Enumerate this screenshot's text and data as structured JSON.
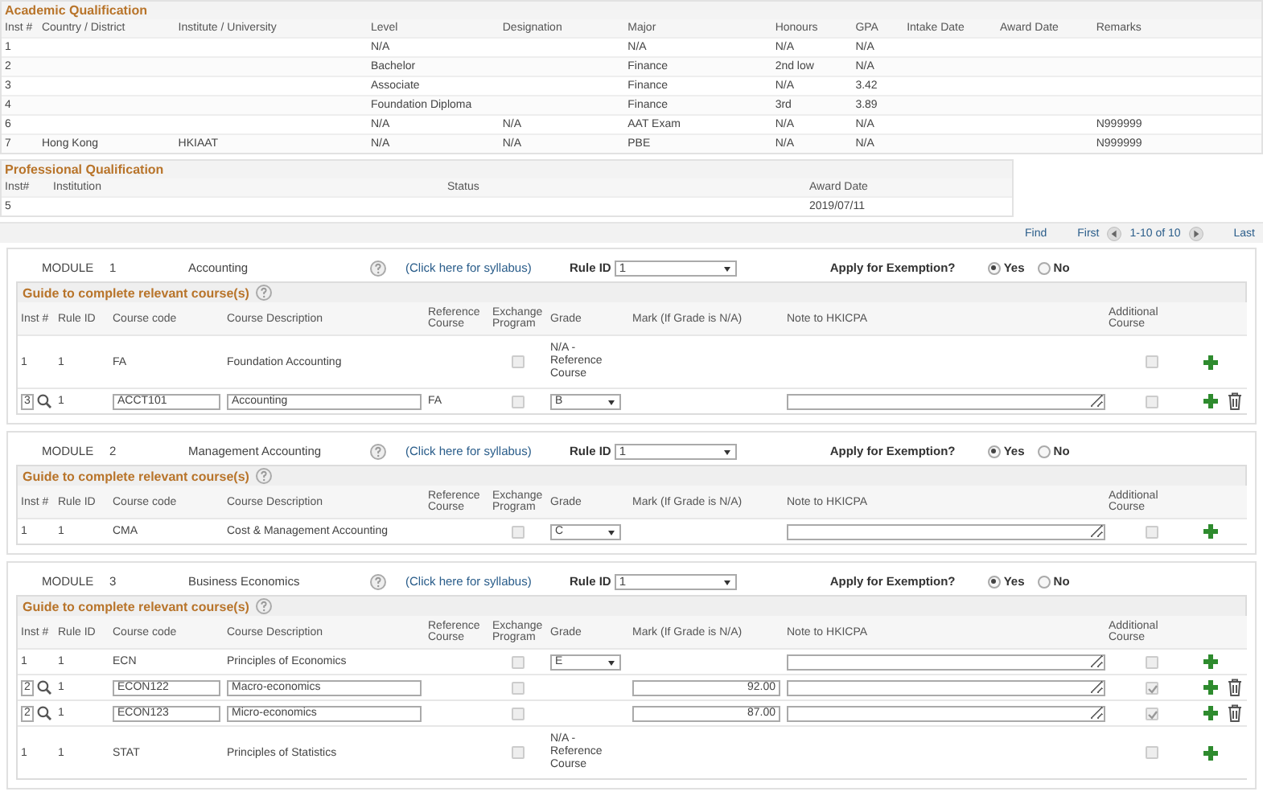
{
  "academic_qualification": {
    "title": "Academic Qualification",
    "columns": [
      "Inst #",
      "Country / District",
      "Institute / University",
      "Level",
      "Designation",
      "Major",
      "Honours",
      "GPA",
      "Intake Date",
      "Award Date",
      "Remarks"
    ],
    "rows": [
      {
        "inst": "1",
        "level": "N/A",
        "major": "N/A",
        "honours": "N/A",
        "gpa": "N/A"
      },
      {
        "inst": "2",
        "level": "Bachelor",
        "major": "Finance",
        "honours": "2nd low",
        "gpa": "N/A"
      },
      {
        "inst": "3",
        "level": "Associate",
        "major": "Finance",
        "honours": "N/A",
        "gpa": "3.42"
      },
      {
        "inst": "4",
        "level": "Foundation Diploma",
        "major": "Finance",
        "honours": "3rd",
        "gpa": "3.89"
      },
      {
        "inst": "6",
        "level": "N/A",
        "designation": "N/A",
        "major": "AAT Exam",
        "honours": "N/A",
        "gpa": "N/A",
        "remarks": "N999999"
      },
      {
        "inst": "7",
        "country": "Hong Kong",
        "institute": "HKIAAT",
        "level": "N/A",
        "designation": "N/A",
        "major": "PBE",
        "honours": "N/A",
        "gpa": "N/A",
        "remarks": "N999999"
      }
    ]
  },
  "professional_qualification": {
    "title": "Professional Qualification",
    "columns": [
      "Inst#",
      "Institution",
      "Status",
      "Award Date"
    ],
    "rows": [
      {
        "inst": "5",
        "award_date": "2019/07/11"
      }
    ]
  },
  "pager": {
    "find": "Find",
    "first": "First",
    "range": "1-10 of 10",
    "last": "Last"
  },
  "modules": [
    {
      "label": "MODULE",
      "number": "1",
      "course_columns": [
        "Inst #",
        "Rule ID",
        "Course code",
        "Course Description",
        "Reference Course",
        "Exchange Program",
        "Grade",
        "Mark (If Grade is N/A)",
        "Note to HKICPA",
        "Additional Course"
      ],
      "name": "Accounting",
      "syllabus_link": "(Click here for syllabus)",
      "rule_label": "Rule ID",
      "rule_id": "1",
      "exemption_label": "Apply for Exemption?",
      "exemption_options": [
        {
          "label": "Yes",
          "selected": true
        },
        {
          "label": "No",
          "selected": false
        }
      ],
      "guide_title": "Guide to complete relevant course(s)",
      "rows": [
        {
          "kind": "fixed",
          "inst": "1",
          "rule_id": "1",
          "code": "FA",
          "description": "Foundation Accounting",
          "exchange_checked": false,
          "grade": {
            "kind": "text",
            "value": "N/A - Reference Course"
          },
          "note_field": false,
          "additional_checked": false,
          "deletable": false
        },
        {
          "kind": "editable",
          "inst": "3",
          "rule_id": "1",
          "code": "ACCT101",
          "description": "Accounting",
          "reference": "FA",
          "exchange_checked": false,
          "grade": {
            "kind": "select",
            "value": "B"
          },
          "note_field": true,
          "additional_checked": false,
          "deletable": true
        }
      ]
    },
    {
      "label": "MODULE",
      "number": "2",
      "course_columns": [
        "Inst #",
        "Rule ID",
        "Course code",
        "Course Description",
        "Reference Course",
        "Exchange Program",
        "Grade",
        "Mark (If Grade is N/A)",
        "Note to HKICPA",
        "Additional Course"
      ],
      "name": "Management Accounting",
      "syllabus_link": "(Click here for syllabus)",
      "rule_label": "Rule ID",
      "rule_id": "1",
      "exemption_label": "Apply for Exemption?",
      "exemption_options": [
        {
          "label": "Yes",
          "selected": true
        },
        {
          "label": "No",
          "selected": false
        }
      ],
      "guide_title": "Guide to complete relevant course(s)",
      "rows": [
        {
          "kind": "fixed",
          "inst": "1",
          "rule_id": "1",
          "code": "CMA",
          "description": "Cost & Management Accounting",
          "exchange_checked": false,
          "grade": {
            "kind": "select",
            "value": "C"
          },
          "note_field": true,
          "additional_checked": false,
          "deletable": false
        }
      ]
    },
    {
      "label": "MODULE",
      "number": "3",
      "course_columns": [
        "Inst #",
        "Rule ID",
        "Course code",
        "Course Description",
        "Reference Course",
        "Exchange Program",
        "Grade",
        "Mark (If Grade is N/A)",
        "Note to HKICPA",
        "Additional Course"
      ],
      "name": "Business Economics",
      "syllabus_link": "(Click here for syllabus)",
      "rule_label": "Rule ID",
      "rule_id": "1",
      "exemption_label": "Apply for Exemption?",
      "exemption_options": [
        {
          "label": "Yes",
          "selected": true
        },
        {
          "label": "No",
          "selected": false
        }
      ],
      "guide_title": "Guide to complete relevant course(s)",
      "rows": [
        {
          "kind": "fixed",
          "inst": "1",
          "rule_id": "1",
          "code": "ECN",
          "description": "Principles of Economics",
          "exchange_checked": false,
          "grade": {
            "kind": "select",
            "value": "E"
          },
          "note_field": true,
          "additional_checked": false,
          "deletable": false
        },
        {
          "kind": "editable",
          "inst": "2",
          "rule_id": "1",
          "code": "ECON122",
          "description": "Macro-economics",
          "exchange_checked": false,
          "mark": "92.00",
          "note_field": true,
          "additional_checked": true,
          "deletable": true
        },
        {
          "kind": "editable",
          "inst": "2",
          "rule_id": "1",
          "code": "ECON123",
          "description": "Micro-economics",
          "exchange_checked": false,
          "mark": "87.00",
          "note_field": true,
          "additional_checked": true,
          "deletable": true
        },
        {
          "kind": "fixed",
          "inst": "1",
          "rule_id": "1",
          "code": "STAT",
          "description": "Principles of Statistics",
          "exchange_checked": false,
          "grade": {
            "kind": "text",
            "value": "N/A - Reference Course"
          },
          "note_field": false,
          "additional_checked": false,
          "deletable": false
        }
      ]
    }
  ]
}
